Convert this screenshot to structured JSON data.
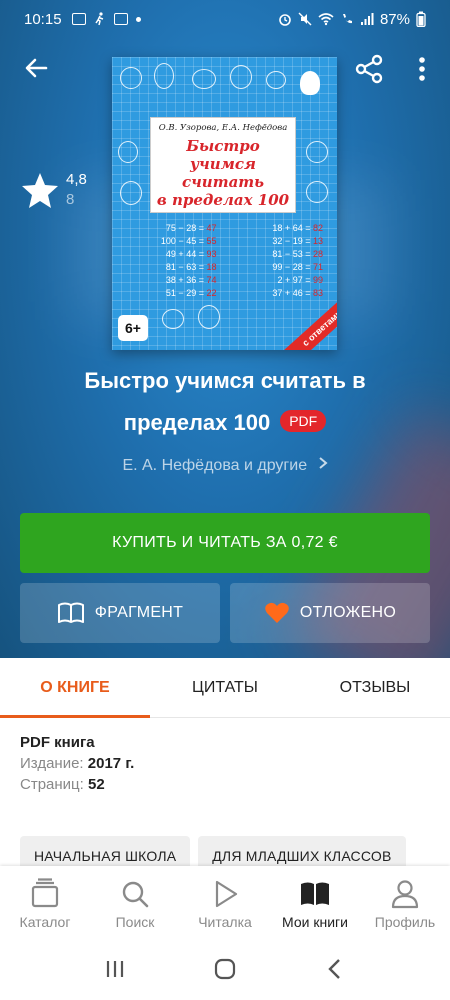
{
  "status_bar": {
    "time": "10:15",
    "battery": "87%"
  },
  "header": {
    "back_icon": "back-arrow-icon",
    "share_icon": "share-icon",
    "more_icon": "more-vert-icon"
  },
  "rating": {
    "value": "4,8",
    "count": "8"
  },
  "cover": {
    "authors": "О.В. Узорова, Е.А. Нефёдова",
    "title_line1": "Быстро учимся",
    "title_line2": "считать",
    "title_line3": "в пределах 100",
    "exercises": [
      {
        "expr": "75 − 28 =",
        "ans": "47"
      },
      {
        "expr": "18 + 64 =",
        "ans": "82"
      },
      {
        "expr": "100 − 45 =",
        "ans": "55"
      },
      {
        "expr": "32 − 19 =",
        "ans": "13"
      },
      {
        "expr": "49 + 44 =",
        "ans": "93"
      },
      {
        "expr": "81 − 53 =",
        "ans": "28"
      },
      {
        "expr": "81 − 63 =",
        "ans": "18"
      },
      {
        "expr": "99 − 28 =",
        "ans": "71"
      },
      {
        "expr": "38 + 36 =",
        "ans": "74"
      },
      {
        "expr": "2 + 97 =",
        "ans": "99"
      },
      {
        "expr": "51 − 29 =",
        "ans": "22"
      },
      {
        "expr": "37 + 46 =",
        "ans": "83"
      }
    ],
    "age": "6+",
    "ribbon": "с ответами"
  },
  "book": {
    "title_line1": "Быстро учимся считать в",
    "title_line2": "пределах 100",
    "format_badge": "PDF",
    "authors": "Е. А. Нефёдова и другие"
  },
  "actions": {
    "buy_label": "КУПИТЬ И ЧИТАТЬ ЗА  0,72 €",
    "fragment_label": "ФРАГМЕНТ",
    "saved_label": "ОТЛОЖЕНО"
  },
  "tabs": [
    {
      "label": "О КНИГЕ",
      "active": true
    },
    {
      "label": "ЦИТАТЫ",
      "active": false
    },
    {
      "label": "ОТЗЫВЫ",
      "active": false
    }
  ],
  "info": {
    "type": "PDF книга",
    "edition_key": "Издание:",
    "edition_val": "2017 г.",
    "pages_key": "Страниц:",
    "pages_val": "52"
  },
  "chips": [
    "НАЧАЛЬНАЯ ШКОЛА",
    "ДЛЯ МЛАДШИХ КЛАССОВ"
  ],
  "bottom_nav": [
    {
      "label": "Каталог",
      "icon": "catalog-icon"
    },
    {
      "label": "Поиск",
      "icon": "search-icon"
    },
    {
      "label": "Читалка",
      "icon": "play-icon"
    },
    {
      "label": "Мои книги",
      "icon": "my-books-icon"
    },
    {
      "label": "Профиль",
      "icon": "profile-icon"
    }
  ],
  "colors": {
    "accent": "#e85c1b",
    "buy_green": "#2fa51f",
    "pdf_red": "#e3262b"
  }
}
